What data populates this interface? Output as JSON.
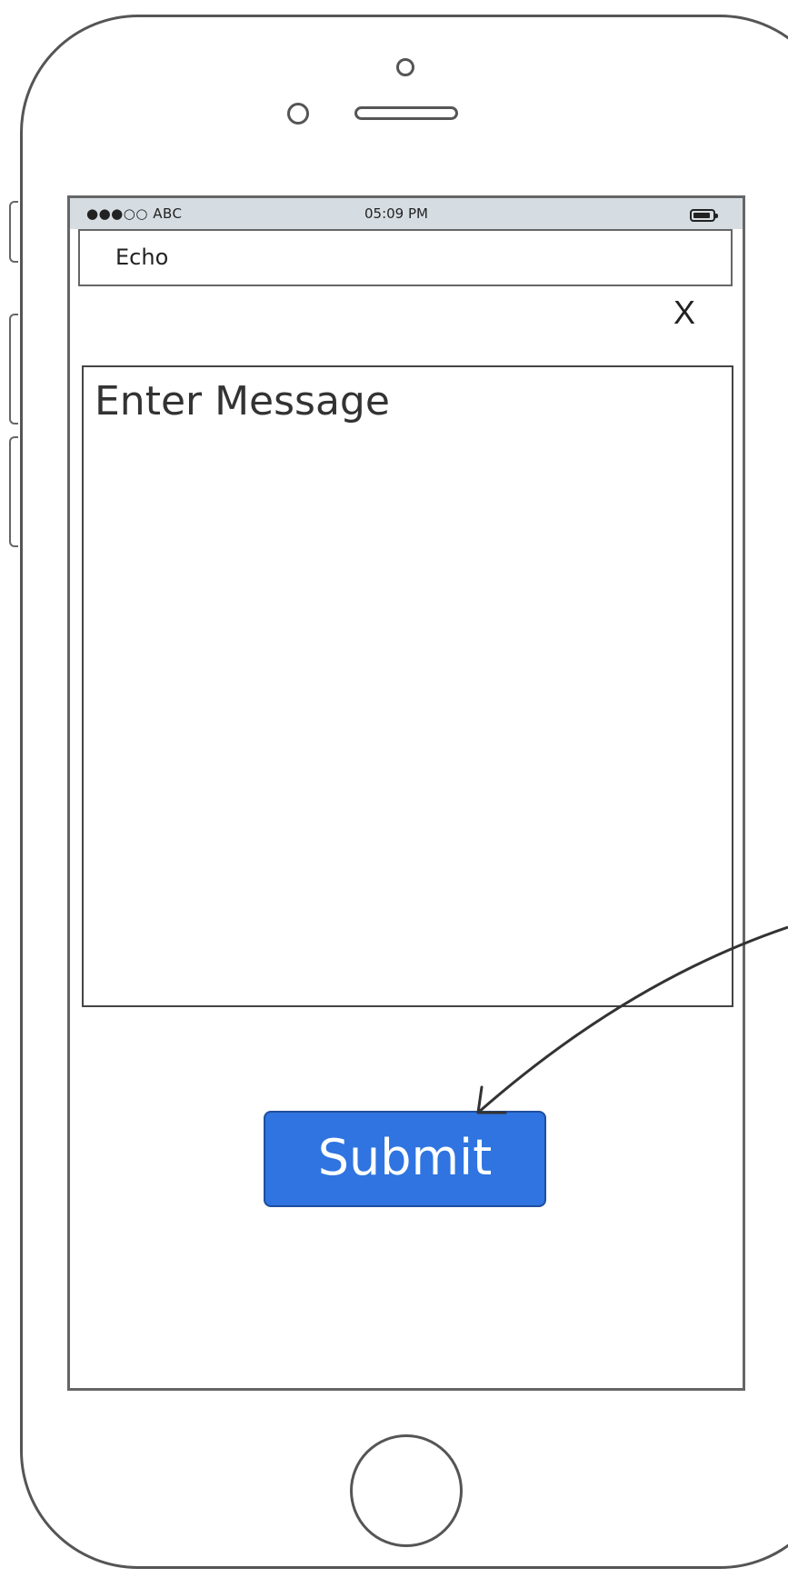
{
  "status_bar": {
    "carrier": "●●●○○ ABC",
    "time": "05:09 PM",
    "battery_icon": "battery-icon"
  },
  "header": {
    "title": "Echo"
  },
  "close_button": {
    "label": "X",
    "icon": "close-icon"
  },
  "message_input": {
    "placeholder": "Enter Message",
    "value": ""
  },
  "submit_button": {
    "label": "Submit",
    "color": "#2f74e0"
  }
}
